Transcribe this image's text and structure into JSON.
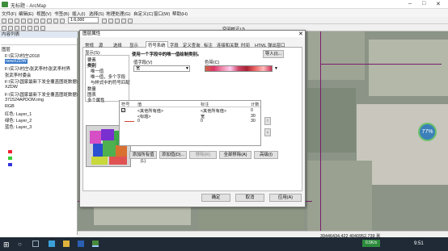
{
  "window": {
    "title": "无标题 - ArcMap"
  },
  "menu": [
    "文件(F)",
    "编辑(E)",
    "视图(V)",
    "书签(B)",
    "插入(I)",
    "选择(S)",
    "地理处理(G)",
    "自定义(C)",
    "窗口(W)",
    "帮助(H)"
  ],
  "toolbar": {
    "scale": "1:6,000",
    "spatial_adjust": "空间校正(J)"
  },
  "toc": {
    "title": "内容列表",
    "items": [
      "图层",
      "F:\\实习\\村庄\\2018",
      "newXZDW",
      "F:\\实习\\村庄\\张武李村\\张武李村界",
      "张武李村委会",
      "F:\\实习\\国家最新下发全覆盖图斑数据\\",
      "XZDW",
      "F:\\实习\\国家最新下发全覆盖图斑数据\\",
      "371524APDOM.img",
      "RGB",
      "红色: Layer_1",
      "绿色: Layer_2",
      "蓝色: Layer_3",
      "",
      "",
      "",
      "",
      "",
      "",
      ""
    ]
  },
  "dialog": {
    "title": "图层属性",
    "tabs": [
      "常规",
      "源",
      "选择",
      "显示",
      "符号系统",
      "字段",
      "定义查询",
      "标注",
      "连接和关联",
      "时间",
      "HTML 弹出窗口"
    ],
    "show_label": "显示(S):",
    "renderers": [
      "要素",
      "类别",
      "唯一值",
      "唯一值，多个字段",
      "与样式中的符号匹配",
      "数量",
      "图表",
      "多个属性"
    ],
    "description": "使用一个字段中的唯一值绘制类别。",
    "import_label": "导入(I)...",
    "value_field_label": "值字段(V)",
    "value_field": "宽",
    "color_ramp_label": "色带(C)",
    "table": {
      "headers": [
        "符号",
        "值",
        "标注",
        "计数"
      ],
      "rows": [
        [
          "",
          "<其他所有值>",
          "<其他所有值>",
          "0"
        ],
        [
          "",
          "<标题>",
          "宽",
          "30"
        ],
        [
          "",
          "0",
          "0",
          "30"
        ]
      ]
    },
    "buttons": [
      "添加所有值(L)",
      "添加值(D)...",
      "移除(R)",
      "全部移除(A)",
      "高级(I)"
    ],
    "ok": "确定",
    "cancel": "取消",
    "apply": "应用(A)"
  },
  "map": {
    "badge": "77%"
  },
  "status": {
    "coords": "39446434.422  4040952.739 米"
  },
  "taskbar": {
    "net": "0.5K/s",
    "time": "9:51"
  }
}
